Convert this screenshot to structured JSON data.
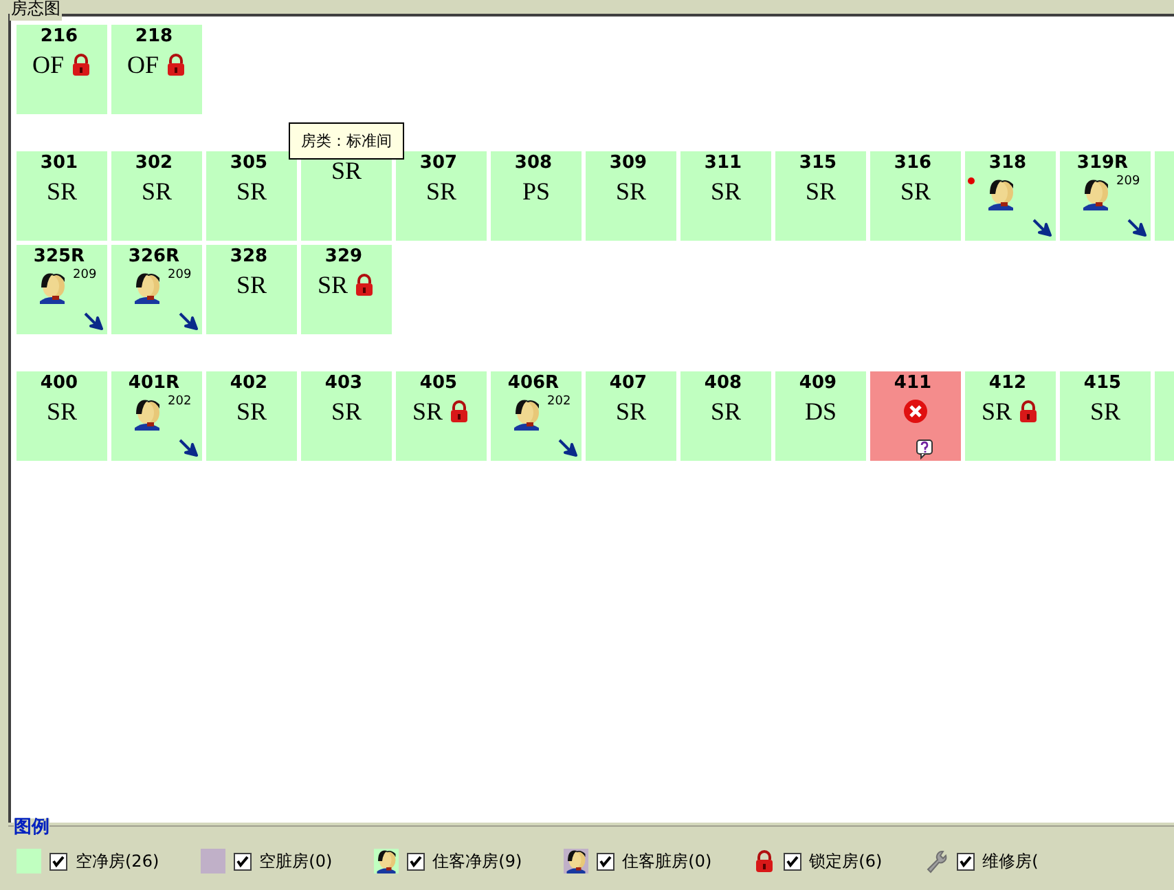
{
  "panel": {
    "title": "房态图"
  },
  "floors": [
    {
      "lines": [
        [
          {
            "number": "216",
            "code": "OF",
            "kind": "vacant",
            "locked": true
          },
          {
            "number": "218",
            "code": "OF",
            "kind": "vacant",
            "locked": true
          }
        ]
      ]
    },
    {
      "lines": [
        [
          {
            "number": "301",
            "code": "SR",
            "kind": "vacant",
            "locked": false
          },
          {
            "number": "302",
            "code": "SR",
            "kind": "vacant",
            "locked": false
          },
          {
            "number": "305",
            "code": "SR",
            "kind": "vacant",
            "locked": false
          },
          {
            "code": "SR",
            "kind": "vacant",
            "locked": false
          },
          {
            "number": "307",
            "code": "SR",
            "kind": "vacant",
            "locked": false
          },
          {
            "number": "308",
            "code": "PS",
            "kind": "vacant",
            "locked": false
          },
          {
            "number": "309",
            "code": "SR",
            "kind": "vacant",
            "locked": false
          },
          {
            "number": "311",
            "code": "SR",
            "kind": "vacant",
            "locked": false
          },
          {
            "number": "315",
            "code": "SR",
            "kind": "vacant",
            "locked": false
          },
          {
            "number": "316",
            "code": "SR",
            "kind": "vacant",
            "locked": false
          },
          {
            "number": "318",
            "kind": "occupied",
            "locked": false,
            "flagged": true
          },
          {
            "number": "319R",
            "kind": "occupied",
            "locked": false,
            "linked": "209"
          },
          {
            "kind": "vacant",
            "locked": false
          }
        ],
        [
          {
            "number": "325R",
            "kind": "occupied",
            "locked": false,
            "linked": "209"
          },
          {
            "number": "326R",
            "kind": "occupied",
            "locked": false,
            "linked": "209"
          },
          {
            "number": "328",
            "code": "SR",
            "kind": "vacant",
            "locked": false
          },
          {
            "number": "329",
            "code": "SR",
            "kind": "vacant",
            "locked": true
          }
        ]
      ]
    },
    {
      "lines": [
        [
          {
            "number": "400",
            "code": "SR",
            "kind": "vacant",
            "locked": false
          },
          {
            "number": "401R",
            "kind": "occupied",
            "locked": false,
            "linked": "202"
          },
          {
            "number": "402",
            "code": "SR",
            "kind": "vacant",
            "locked": false
          },
          {
            "number": "403",
            "code": "SR",
            "kind": "vacant",
            "locked": false
          },
          {
            "number": "405",
            "code": "SR",
            "kind": "vacant",
            "locked": true
          },
          {
            "number": "406R",
            "kind": "occupied",
            "locked": false,
            "linked": "202"
          },
          {
            "number": "407",
            "code": "SR",
            "kind": "vacant",
            "locked": false
          },
          {
            "number": "408",
            "code": "SR",
            "kind": "vacant",
            "locked": false
          },
          {
            "number": "409",
            "code": "DS",
            "kind": "vacant",
            "locked": false
          },
          {
            "number": "411",
            "kind": "problem",
            "locked": false
          },
          {
            "number": "412",
            "code": "SR",
            "kind": "vacant",
            "locked": true
          },
          {
            "number": "415",
            "code": "SR",
            "kind": "vacant",
            "locked": false
          },
          {
            "kind": "vacant",
            "locked": false
          }
        ]
      ]
    }
  ],
  "tooltip": {
    "text": "房类：标准间"
  },
  "legend": {
    "title": "图例",
    "items": [
      {
        "kind": "swatch",
        "color": "#c0ffc0",
        "label": "空净房(26)",
        "checked": true
      },
      {
        "kind": "swatch",
        "color": "#c0b0c8",
        "label": "空脏房(0)",
        "checked": true
      },
      {
        "kind": "guest",
        "label": "住客净房(9)",
        "checked": true
      },
      {
        "kind": "guest-dirty",
        "label": "住客脏房(0)",
        "checked": true
      },
      {
        "kind": "lock",
        "label": "锁定房(6)",
        "checked": true
      },
      {
        "kind": "wrench",
        "label": "维修房(",
        "checked": true
      }
    ]
  }
}
